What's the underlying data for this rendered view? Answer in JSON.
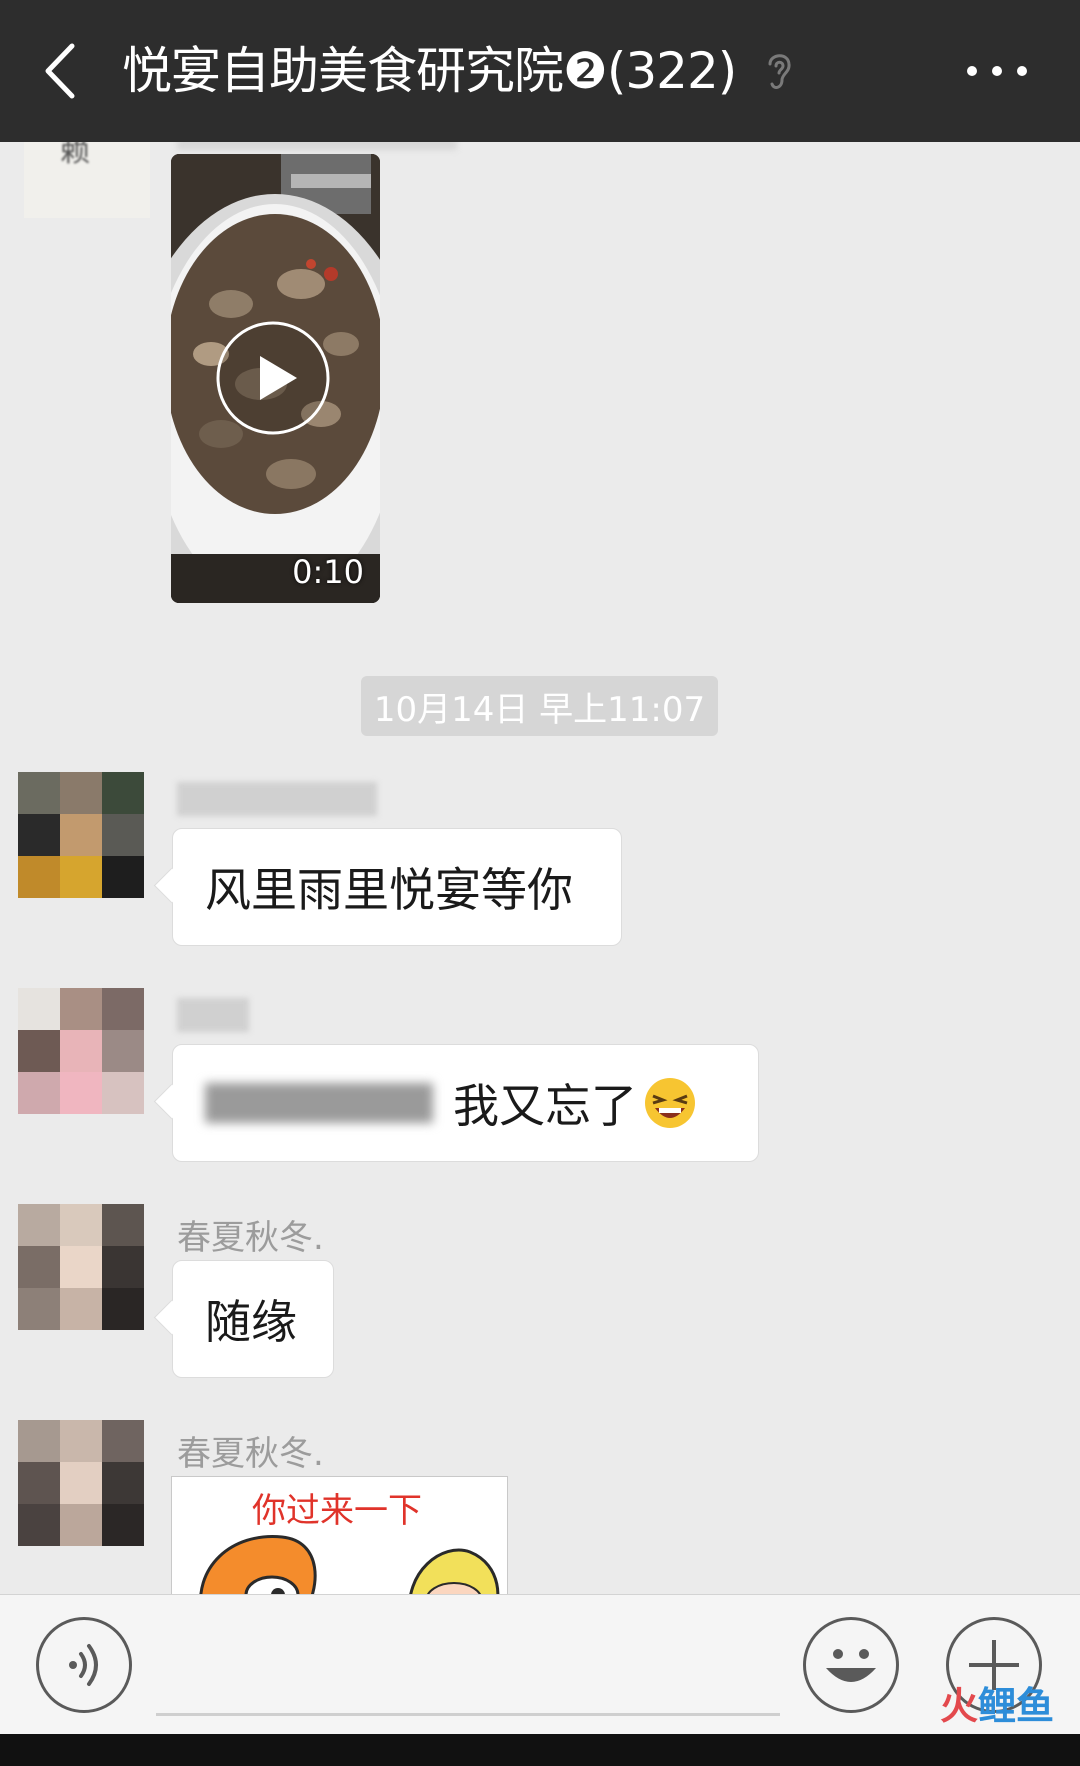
{
  "header": {
    "title": "悦宴自助美食研究院❷(322)",
    "back_icon": "chevron-left-icon",
    "ear_icon": "ear-icon",
    "more_icon": "more-dots-icon"
  },
  "messages": [
    {
      "type": "video",
      "duration": "0:10",
      "avatar_icon": "avatar"
    },
    {
      "type": "timestamp",
      "text": "10月14日 早上11:07"
    },
    {
      "type": "text",
      "text": "风里雨里悦宴等你"
    },
    {
      "type": "text",
      "text_suffix": "我又忘了"
    },
    {
      "type": "text",
      "nickname": "春夏秋冬.",
      "text": "随缘"
    },
    {
      "type": "sticker",
      "nickname": "春夏秋冬.",
      "sticker_text": "你过来一下"
    }
  ],
  "input_bar": {
    "voice_icon": "voice-icon",
    "emoji_icon": "smiley-icon",
    "plus_icon": "plus-icon"
  },
  "watermark": {
    "part1": "火",
    "part2": "鲤鱼"
  },
  "colors": {
    "header_bg": "#2d2d2d",
    "chat_bg": "#ebebeb",
    "bubble_bg": "#ffffff",
    "nick_color": "#9c9c9c",
    "timestamp_bg": "#d6d6d6"
  }
}
